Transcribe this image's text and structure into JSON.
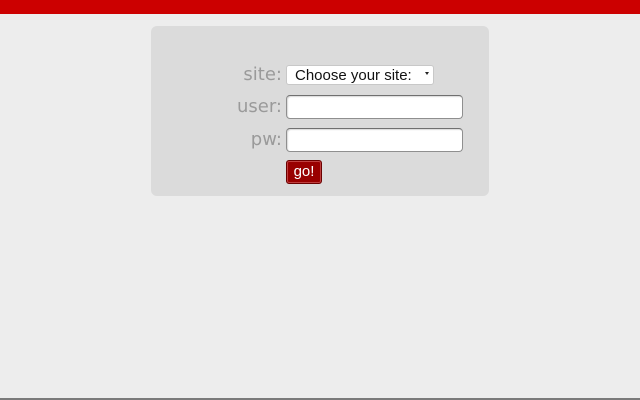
{
  "colors": {
    "top_bar": "#cc0000",
    "background": "#ededed",
    "panel": "#dbdbdb",
    "label": "#9a9a9a",
    "go_button": "#990000"
  },
  "login_form": {
    "site_label": "site:",
    "site_select": {
      "selected": "Choose your site:",
      "icon": "dropdown-arrow-icon"
    },
    "user_label": "user:",
    "user_value": "",
    "pw_label": "pw:",
    "pw_value": "",
    "submit_label": "go!"
  }
}
